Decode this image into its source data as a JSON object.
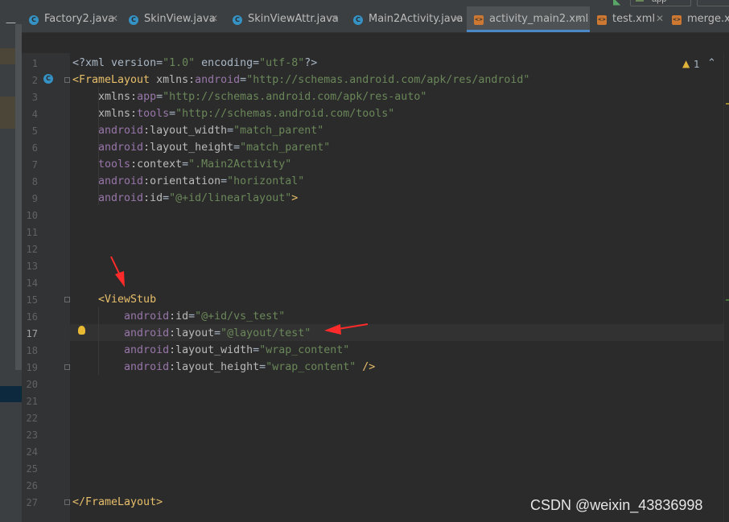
{
  "toolbar": {
    "run_config": "app"
  },
  "tabs": [
    {
      "label": "Factory2.java",
      "kind": "java",
      "active": false
    },
    {
      "label": "SkinView.java",
      "kind": "java",
      "active": false
    },
    {
      "label": "SkinViewAttr.java",
      "kind": "java",
      "active": false
    },
    {
      "label": "Main2Activity.java",
      "kind": "java",
      "active": false
    },
    {
      "label": "activity_main2.xml",
      "kind": "xml",
      "active": true
    },
    {
      "label": "test.xml",
      "kind": "xml",
      "active": false
    },
    {
      "label": "merge.xml",
      "kind": "xml",
      "active": false
    }
  ],
  "inspection": {
    "warning_count": "1"
  },
  "icons": {
    "java_class": "class-c-icon",
    "xml_file": "xml-file-icon",
    "warning": "warning-triangle-icon",
    "intention": "lightbulb-icon",
    "close": "close-icon"
  },
  "colors": {
    "editor_bg": "#2b2b2b",
    "gutter_bg": "#313335",
    "tag": "#e8bf6a",
    "namespace": "#9876aa",
    "attribute": "#bababa",
    "value": "#6a8759",
    "annotation_arrow": "#ff2a2a"
  },
  "editor": {
    "current_line": 17,
    "lines": [
      {
        "n": "1",
        "tokens": [
          [
            "t-plain",
            "<?xml version="
          ],
          [
            "t-val",
            "\"1.0\""
          ],
          [
            "t-plain",
            " encoding="
          ],
          [
            "t-val",
            "\"utf-8\""
          ],
          [
            "t-plain",
            "?>"
          ]
        ]
      },
      {
        "n": "2",
        "tokens": [
          [
            "t-tag",
            "<FrameLayout "
          ],
          [
            "t-attr",
            "xmlns:"
          ],
          [
            "t-ns",
            "android"
          ],
          [
            "t-plain",
            "="
          ],
          [
            "t-val",
            "\"http://schemas.android.com/apk/res/android\""
          ]
        ]
      },
      {
        "n": "3",
        "tokens": [
          [
            "t-attr",
            "    xmlns:"
          ],
          [
            "t-ns",
            "app"
          ],
          [
            "t-plain",
            "="
          ],
          [
            "t-val",
            "\"http://schemas.android.com/apk/res-auto\""
          ]
        ]
      },
      {
        "n": "4",
        "tokens": [
          [
            "t-attr",
            "    xmlns:"
          ],
          [
            "t-ns",
            "tools"
          ],
          [
            "t-plain",
            "="
          ],
          [
            "t-val",
            "\"http://schemas.android.com/tools\""
          ]
        ]
      },
      {
        "n": "5",
        "tokens": [
          [
            "t-ns",
            "    android"
          ],
          [
            "t-attr",
            ":layout_width"
          ],
          [
            "t-plain",
            "="
          ],
          [
            "t-val",
            "\"match_parent\""
          ]
        ]
      },
      {
        "n": "6",
        "tokens": [
          [
            "t-ns",
            "    android"
          ],
          [
            "t-attr",
            ":layout_height"
          ],
          [
            "t-plain",
            "="
          ],
          [
            "t-val",
            "\"match_parent\""
          ]
        ]
      },
      {
        "n": "7",
        "tokens": [
          [
            "t-ns",
            "    tools"
          ],
          [
            "t-attr",
            ":context"
          ],
          [
            "t-plain",
            "="
          ],
          [
            "t-val",
            "\".Main2Activity\""
          ]
        ]
      },
      {
        "n": "8",
        "tokens": [
          [
            "t-ns",
            "    android"
          ],
          [
            "t-attr",
            ":orientation"
          ],
          [
            "t-plain",
            "="
          ],
          [
            "t-val",
            "\"horizontal\""
          ]
        ]
      },
      {
        "n": "9",
        "tokens": [
          [
            "t-ns",
            "    android"
          ],
          [
            "t-attr",
            ":id"
          ],
          [
            "t-plain",
            "="
          ],
          [
            "t-val",
            "\"@+id/linearlayout\""
          ],
          [
            "t-tag",
            ">"
          ]
        ]
      },
      {
        "n": "10",
        "tokens": []
      },
      {
        "n": "11",
        "tokens": []
      },
      {
        "n": "12",
        "tokens": []
      },
      {
        "n": "13",
        "tokens": []
      },
      {
        "n": "14",
        "tokens": []
      },
      {
        "n": "15",
        "tokens": [
          [
            "t-tag",
            "    <ViewStub"
          ]
        ]
      },
      {
        "n": "16",
        "tokens": [
          [
            "t-ns",
            "        android"
          ],
          [
            "t-attr",
            ":id"
          ],
          [
            "t-plain",
            "="
          ],
          [
            "t-val",
            "\"@+id/vs_test\""
          ]
        ]
      },
      {
        "n": "17",
        "tokens": [
          [
            "t-ns",
            "        android"
          ],
          [
            "t-attr",
            ":layout"
          ],
          [
            "t-plain",
            "="
          ],
          [
            "t-val",
            "\"@layout/test\""
          ]
        ]
      },
      {
        "n": "18",
        "tokens": [
          [
            "t-ns",
            "        android"
          ],
          [
            "t-attr",
            ":layout_width"
          ],
          [
            "t-plain",
            "="
          ],
          [
            "t-val",
            "\"wrap_content\""
          ]
        ]
      },
      {
        "n": "19",
        "tokens": [
          [
            "t-ns",
            "        android"
          ],
          [
            "t-attr",
            ":layout_height"
          ],
          [
            "t-plain",
            "="
          ],
          [
            "t-val",
            "\"wrap_content\""
          ],
          [
            "t-tag",
            " />"
          ]
        ]
      },
      {
        "n": "20",
        "tokens": []
      },
      {
        "n": "21",
        "tokens": []
      },
      {
        "n": "22",
        "tokens": []
      },
      {
        "n": "23",
        "tokens": []
      },
      {
        "n": "24",
        "tokens": []
      },
      {
        "n": "25",
        "tokens": []
      },
      {
        "n": "26",
        "tokens": []
      },
      {
        "n": "27",
        "tokens": [
          [
            "t-tag",
            "</FrameLayout>"
          ]
        ]
      }
    ]
  },
  "watermark": "CSDN @weixin_43836998"
}
